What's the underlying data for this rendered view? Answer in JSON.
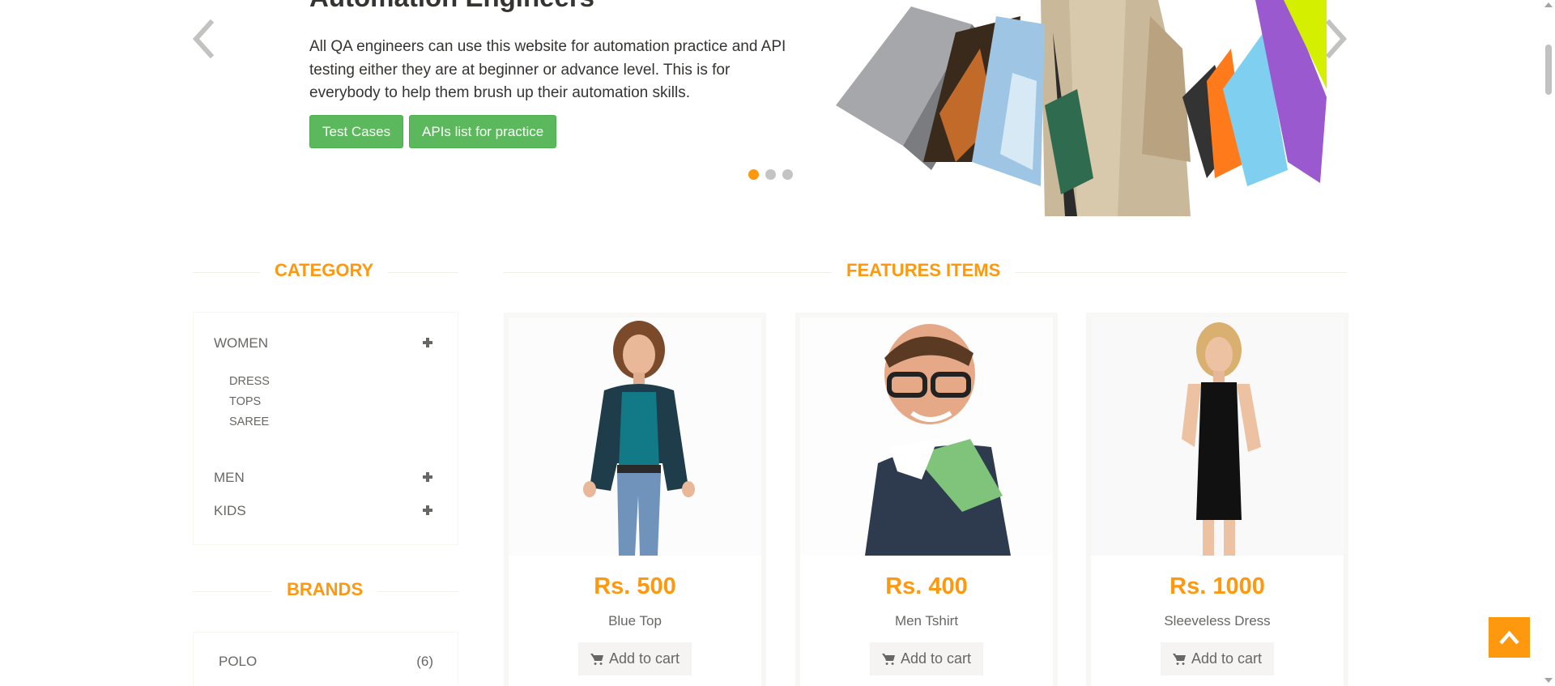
{
  "slider": {
    "title": "Automation Engineers",
    "description": "All QA engineers can use this website for automation practice and API testing either they are at beginner or advance level. This is for everybody to help them brush up their automation skills.",
    "buttons": {
      "test_cases": "Test Cases",
      "apis": "APIs list for practice"
    },
    "active_slide": 1,
    "slide_count": 3
  },
  "category": {
    "heading": "Category",
    "groups": [
      {
        "label": "Women",
        "sub_items": [
          "Dress",
          "Tops",
          "Saree"
        ]
      },
      {
        "label": "Men"
      },
      {
        "label": "Kids"
      }
    ]
  },
  "brands": {
    "heading": "Brands",
    "items": [
      {
        "label": "Polo",
        "count": "(6)"
      }
    ]
  },
  "features": {
    "heading": "Features Items",
    "products": [
      {
        "price": "Rs. 500",
        "name": "Blue Top",
        "cart_label": "Add to cart"
      },
      {
        "price": "Rs. 400",
        "name": "Men Tshirt",
        "cart_label": "Add to cart"
      },
      {
        "price": "Rs. 1000",
        "name": "Sleeveless Dress",
        "cart_label": "Add to cart"
      }
    ]
  },
  "colors": {
    "accent": "#FE980F",
    "green": "#5CB85C",
    "text": "#696763"
  },
  "icons": [
    "chevron-left-icon",
    "chevron-right-icon",
    "plus-icon",
    "shopping-cart-icon",
    "angle-up-icon"
  ]
}
